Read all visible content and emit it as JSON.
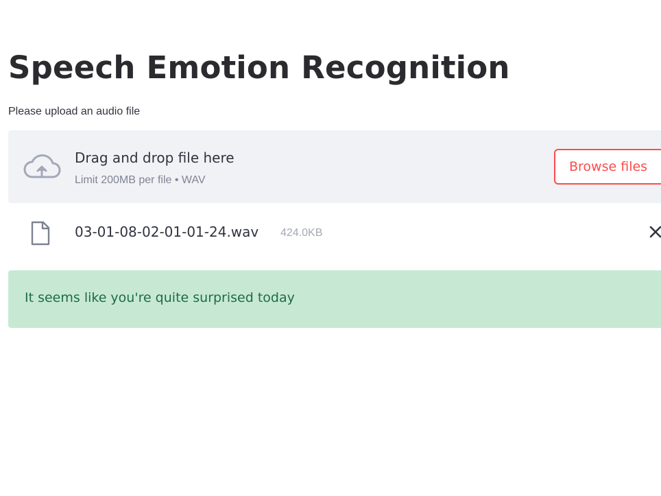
{
  "page": {
    "title": "Speech Emotion Recognition"
  },
  "uploader": {
    "label": "Please upload an audio file",
    "dropzone_title": "Drag and drop file here",
    "dropzone_limit": "Limit 200MB per file • WAV",
    "browse_label": "Browse files",
    "icon": "cloud-upload-icon"
  },
  "uploaded_file": {
    "name": "03-01-08-02-01-01-24.wav",
    "size": "424.0KB",
    "icon": "file-icon",
    "remove_icon": "close-icon"
  },
  "result": {
    "message": "It seems like you're quite surprised today"
  },
  "colors": {
    "accent": "#ff4b4b",
    "dropzone_bg": "#f0f2f6",
    "success_bg": "#c7e9d3",
    "success_text": "#1e6b45"
  }
}
